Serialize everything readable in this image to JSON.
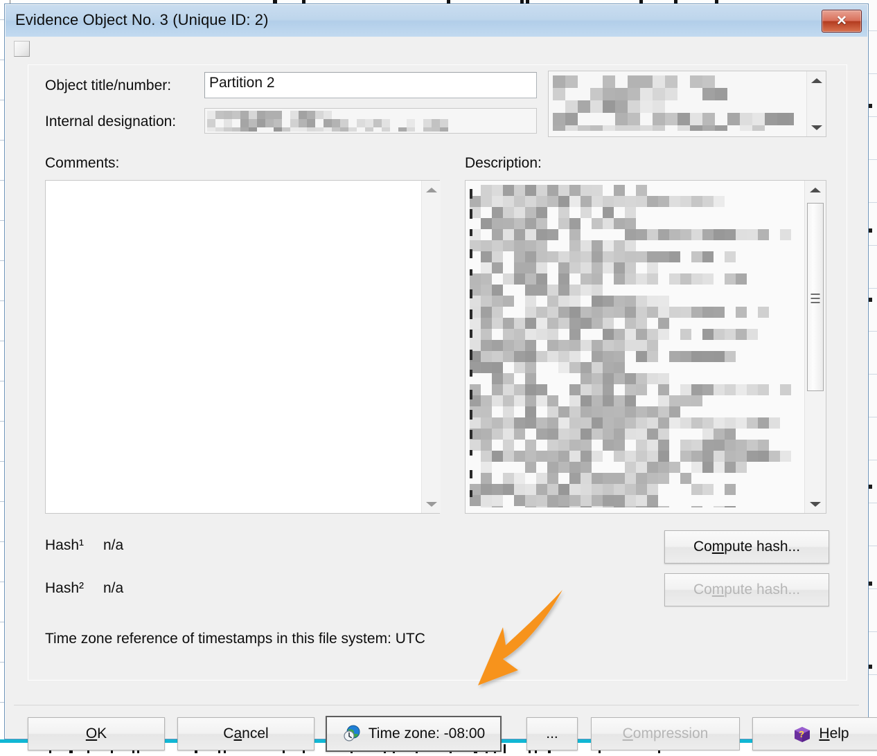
{
  "window": {
    "title": "Evidence Object No. 3 (Unique ID: 2)",
    "close_label": "✕",
    "close_icon": "close-icon"
  },
  "form": {
    "object_title_label": "Object title/number:",
    "object_title_value": "Partition 2",
    "object_title_placeholder": "",
    "internal_designation_label": "Internal designation:",
    "internal_designation_value": "",
    "comments_label": "Comments:",
    "comments_value": "",
    "description_label": "Description:"
  },
  "hashes": {
    "hash1_label": "Hash¹",
    "hash1_value": "n/a",
    "hash2_label": "Hash²",
    "hash2_value": "n/a",
    "compute_hash_1": "Compute hash...",
    "compute_hash_1_mnemonic": "m",
    "compute_hash_2": "Compute hash...",
    "compute_hash_2_mnemonic": "m"
  },
  "timezone_note": "Time zone reference of timestamps in this file system: UTC",
  "footer": {
    "ok": "OK",
    "ok_mnemonic": "O",
    "cancel": "Cancel",
    "cancel_mnemonic": "a",
    "timezone": "Time zone: -08:00",
    "timezone_icon": "globe-clock-icon",
    "ellipsis": "...",
    "compression": "Compression",
    "compression_mnemonic": "C",
    "help": "Help",
    "help_mnemonic": "H",
    "help_icon": "help-book-icon"
  },
  "annotation": {
    "arrow_icon": "orange-arrow-icon",
    "arrow_color": "#F7931E",
    "points_at": "timezone-button"
  },
  "colors": {
    "titlebar_top": "#c9dcef",
    "titlebar_bottom": "#c2daf0",
    "dialog_face": "#f0f0f0",
    "close_button": "#b33c20",
    "accent_bottom_strip": "#11b7d4",
    "annotation_orange": "#F7931E"
  }
}
